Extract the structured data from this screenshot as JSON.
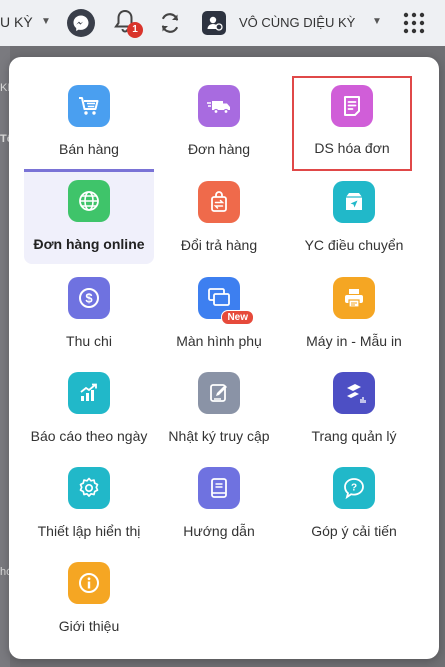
{
  "topbar": {
    "store_name": "U KỲ",
    "notification_count": "1",
    "user_name": "VÔ CÙNG DIỆU KỲ"
  },
  "background": {
    "snippets": [
      "KI",
      "Tổ",
      "hó"
    ]
  },
  "menu": {
    "items": [
      {
        "label": "Bán hàng",
        "icon": "cart-icon",
        "color": "#4a9ff0"
      },
      {
        "label": "Đơn hàng",
        "icon": "delivery-truck-icon",
        "color": "#a86be0"
      },
      {
        "label": "DS hóa đơn",
        "icon": "invoice-icon",
        "color": "#d05ed8"
      },
      {
        "label": "Đơn hàng online",
        "icon": "globe-icon",
        "color": "#3fc46a"
      },
      {
        "label": "Đổi trả hàng",
        "icon": "return-bag-icon",
        "color": "#ef6a4b"
      },
      {
        "label": "YC điều chuyển",
        "icon": "transfer-box-icon",
        "color": "#21b8c9"
      },
      {
        "label": "Thu chi",
        "icon": "dollar-coin-icon",
        "color": "#6f72e0"
      },
      {
        "label": "Màn hình phụ",
        "icon": "secondary-screen-icon",
        "color": "#3d7ff0",
        "badge": "New"
      },
      {
        "label": "Máy in - Mẫu in",
        "icon": "printer-icon",
        "color": "#f5a623"
      },
      {
        "label": "Báo cáo theo ngày",
        "icon": "chart-up-icon",
        "color": "#21b8c9"
      },
      {
        "label": "Nhật ký truy cập",
        "icon": "edit-note-icon",
        "color": "#8a93a6"
      },
      {
        "label": "Trang quản lý",
        "icon": "management-logo-icon",
        "color": "#4d4fc4"
      },
      {
        "label": "Thiết lập hiển thị",
        "icon": "gear-icon",
        "color": "#21b8c9"
      },
      {
        "label": "Hướng dẫn",
        "icon": "guide-book-icon",
        "color": "#6f72e0"
      },
      {
        "label": "Góp ý cải tiến",
        "icon": "feedback-bubble-icon",
        "color": "#21b8c9"
      },
      {
        "label": "Giới thiệu",
        "icon": "info-icon",
        "color": "#f5a623"
      }
    ],
    "active_item": "Đơn hàng online",
    "highlighted_item": "DS hóa đơn"
  }
}
